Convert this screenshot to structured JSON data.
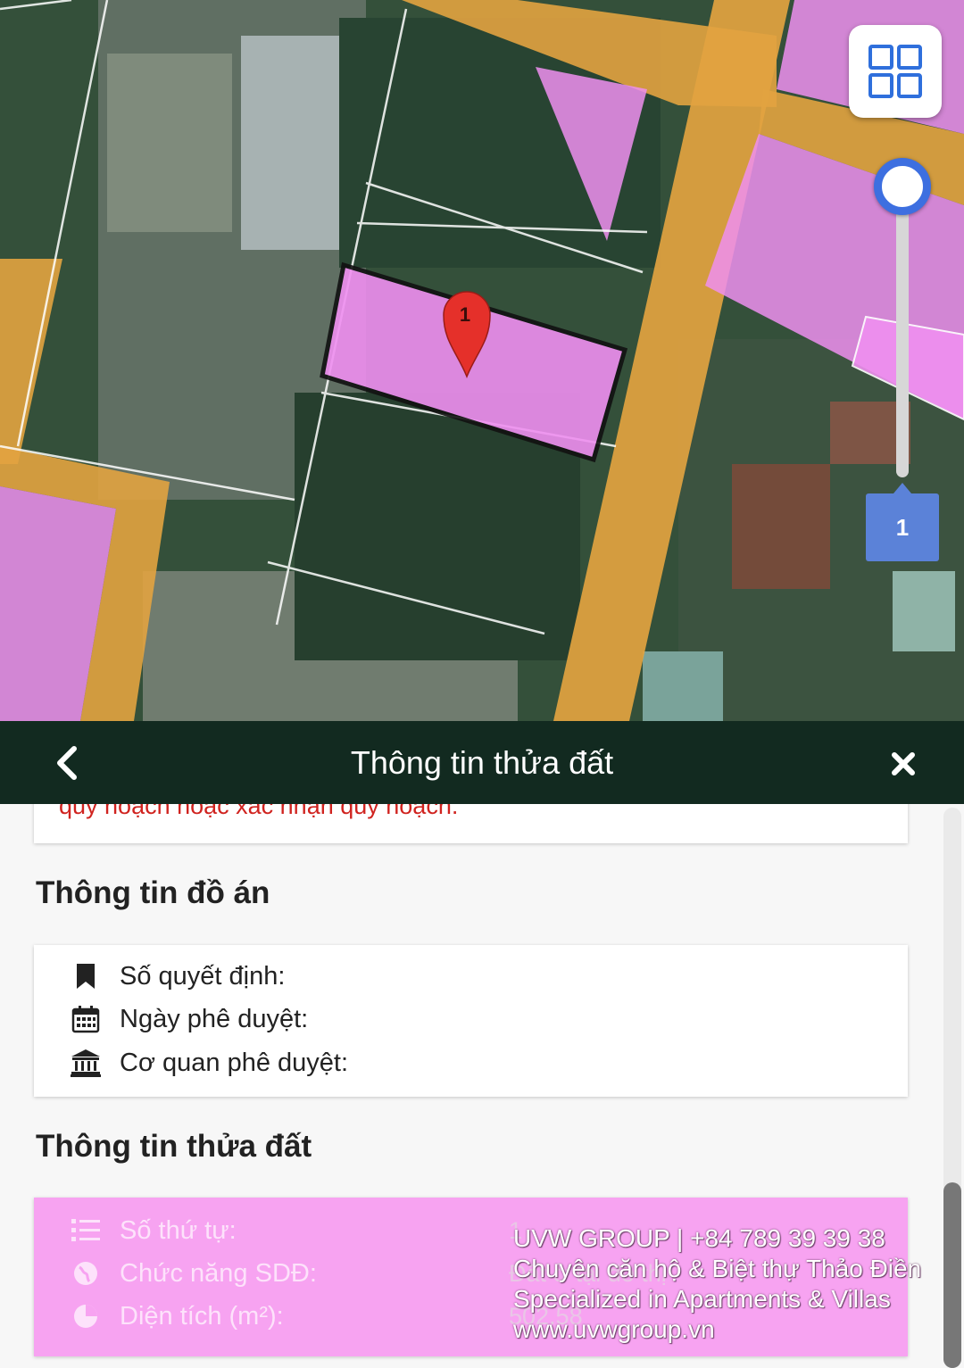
{
  "map": {
    "marker_label": "1",
    "page_badge": "1",
    "colors": {
      "road": "#e2a340",
      "residential": "#ef8ff0",
      "selected_outline": "#111111",
      "marker": "#e5302a",
      "accent": "#3d6fe0"
    },
    "icons": {
      "layers": "grid-layers-icon",
      "marker": "map-marker-icon"
    }
  },
  "header": {
    "title": "Thông tin thửa đất",
    "back_icon": "chevron-left-icon",
    "close_icon": "close-icon"
  },
  "notice": {
    "text": "quy hoạch hoặc xác nhận quy hoạch."
  },
  "do_an": {
    "title": "Thông tin đồ án",
    "rows": [
      {
        "icon": "bookmark-icon",
        "label": "Số quyết định:"
      },
      {
        "icon": "calendar-icon",
        "label": "Ngày phê duyệt:"
      },
      {
        "icon": "bank-icon",
        "label": "Cơ quan phê duyệt:"
      }
    ]
  },
  "thua_dat": {
    "title": "Thông tin thửa đất",
    "rows": [
      {
        "icon": "list-icon",
        "label": "Số thứ tự:",
        "value": "1"
      },
      {
        "icon": "globe-icon",
        "label": "Chức năng SDĐ:",
        "value": "Đất ở tại đô thị"
      },
      {
        "icon": "pie-chart-icon",
        "label": "Diện tích (m²):",
        "value": "502.58"
      }
    ]
  },
  "watermark": {
    "line1": "UVW GROUP | +84 789 39 39 38",
    "line2": "Chuyên căn hộ & Biệt thự Thảo Điền",
    "line3": "Specialized in Apartments & Villas",
    "line4": "www.uvwgroup.vn"
  }
}
